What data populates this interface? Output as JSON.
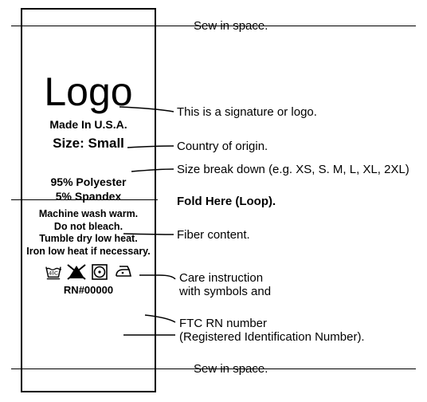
{
  "tag": {
    "logo": "Logo",
    "made_in": "Made In U.S.A.",
    "size_label": "Size:",
    "size_value": "Small",
    "fiber_line1": "95% Polyester",
    "fiber_line2": "5% Spandex",
    "care_line1": "Machine wash warm.",
    "care_line2": "Do not bleach.",
    "care_line3": "Tumble dry low heat.",
    "care_line4": "Iron low heat if necessary.",
    "rn": "RN#00000"
  },
  "annotations": {
    "sew_top": "Sew in space.",
    "logo": "This is a signature or logo.",
    "origin": "Country of origin.",
    "size": "Size break down (e.g. XS, S. M, L, XL, 2XL)",
    "fold": "Fold Here (Loop).",
    "fiber": "Fiber content.",
    "care_l1": "Care instruction",
    "care_l2": "with symbols and",
    "rn_l1": "FTC  RN number",
    "rn_l2": "(Registered Identification Number).",
    "sew_bot": "Sew in space."
  },
  "icons": {
    "wash": "wash-icon",
    "no_bleach": "no-bleach-icon",
    "tumble_dry": "tumble-dry-icon",
    "iron": "iron-icon"
  }
}
